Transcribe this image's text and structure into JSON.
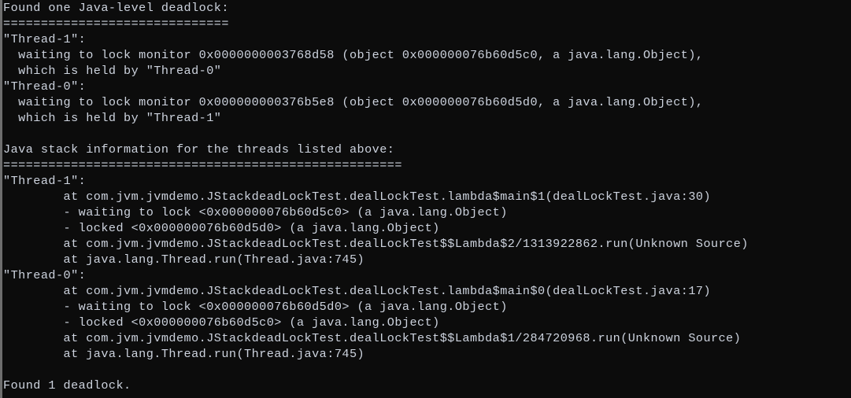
{
  "terminal": {
    "title": "jstack deadlock output",
    "background_color": "#0c0c0c",
    "text_color": "#cdd3de",
    "gutter_color": "#6e6e6e",
    "font_size_px": 15,
    "line_height_px": 20,
    "columns_visible": 108,
    "rows_visible": 25
  },
  "summary": {
    "deadlock_header": "Found one Java-level deadlock:",
    "deadlock_footer": "Found 1 deadlock.",
    "stack_header": "Java stack information for the threads listed above:",
    "separator_short": "==============================",
    "separator_long": "====================================================="
  },
  "threads": [
    {
      "name": "\"Thread-1\"",
      "waiting_monitor": "0x0000000003768d58",
      "waiting_object": "0x000000076b60d5c0",
      "object_class": "a java.lang.Object",
      "held_by": "\"Thread-0\""
    },
    {
      "name": "\"Thread-0\"",
      "waiting_monitor": "0x000000000376b5e8",
      "waiting_object": "0x000000076b60d5d0",
      "object_class": "a java.lang.Object",
      "held_by": "\"Thread-1\""
    }
  ],
  "stacks": [
    {
      "thread": "\"Thread-1\"",
      "frames": [
        "at com.jvm.jvmdemo.JStackdeadLockTest.dealLockTest.lambda$main$1(dealLockTest.java:30)",
        "- waiting to lock <0x000000076b60d5c0> (a java.lang.Object)",
        "- locked <0x000000076b60d5d0> (a java.lang.Object)",
        "at com.jvm.jvmdemo.JStackdeadLockTest.dealLockTest$$Lambda$2/1313922862.run(Unknown Source)",
        "at java.lang.Thread.run(Thread.java:745)"
      ]
    },
    {
      "thread": "\"Thread-0\"",
      "frames": [
        "at com.jvm.jvmdemo.JStackdeadLockTest.dealLockTest.lambda$main$0(dealLockTest.java:17)",
        "- waiting to lock <0x000000076b60d5d0> (a java.lang.Object)",
        "- locked <0x000000076b60d5c0> (a java.lang.Object)",
        "at com.jvm.jvmdemo.JStackdeadLockTest.dealLockTest$$Lambda$1/284720968.run(Unknown Source)",
        "at java.lang.Thread.run(Thread.java:745)"
      ]
    }
  ],
  "lines": [
    "Found one Java-level deadlock:",
    "==============================",
    "\"Thread-1\":",
    "  waiting to lock monitor 0x0000000003768d58 (object 0x000000076b60d5c0, a java.lang.Object),",
    "  which is held by \"Thread-0\"",
    "\"Thread-0\":",
    "  waiting to lock monitor 0x000000000376b5e8 (object 0x000000076b60d5d0, a java.lang.Object),",
    "  which is held by \"Thread-1\"",
    "",
    "Java stack information for the threads listed above:",
    "=====================================================",
    "\"Thread-1\":",
    "        at com.jvm.jvmdemo.JStackdeadLockTest.dealLockTest.lambda$main$1(dealLockTest.java:30)",
    "        - waiting to lock <0x000000076b60d5c0> (a java.lang.Object)",
    "        - locked <0x000000076b60d5d0> (a java.lang.Object)",
    "        at com.jvm.jvmdemo.JStackdeadLockTest.dealLockTest$$Lambda$2/1313922862.run(Unknown Source)",
    "        at java.lang.Thread.run(Thread.java:745)",
    "\"Thread-0\":",
    "        at com.jvm.jvmdemo.JStackdeadLockTest.dealLockTest.lambda$main$0(dealLockTest.java:17)",
    "        - waiting to lock <0x000000076b60d5d0> (a java.lang.Object)",
    "        - locked <0x000000076b60d5c0> (a java.lang.Object)",
    "        at com.jvm.jvmdemo.JStackdeadLockTest.dealLockTest$$Lambda$1/284720968.run(Unknown Source)",
    "        at java.lang.Thread.run(Thread.java:745)",
    "",
    "Found 1 deadlock."
  ]
}
